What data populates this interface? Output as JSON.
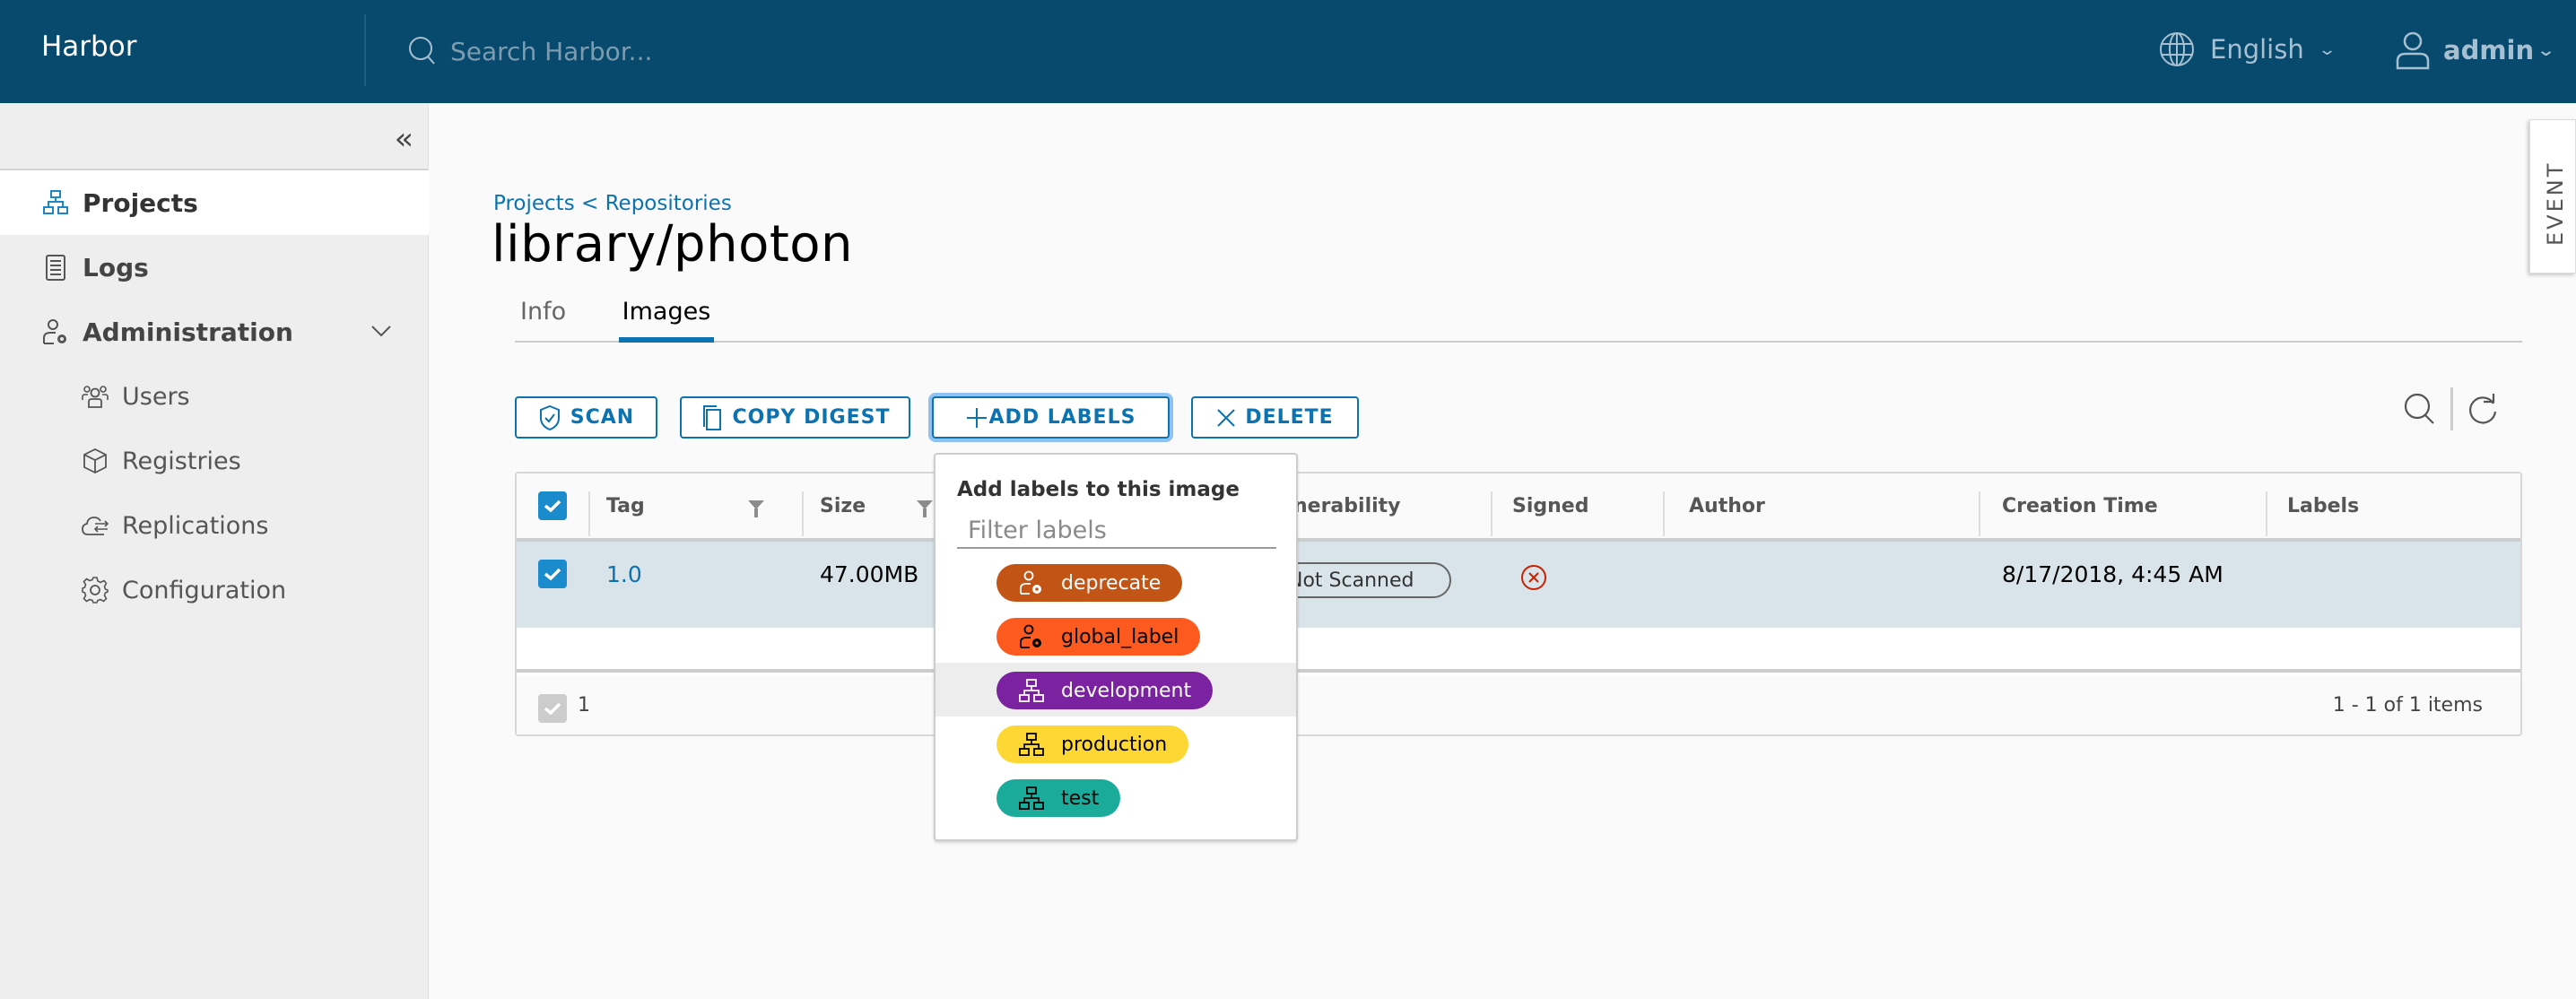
{
  "header": {
    "brand": "Harbor",
    "search_placeholder": "Search Harbor...",
    "language": "English",
    "user": "admin"
  },
  "sidebar": {
    "collapse_icon": "double-chevron-left-icon",
    "items": [
      {
        "label": "Projects",
        "icon": "projects-icon",
        "active": true
      },
      {
        "label": "Logs",
        "icon": "logs-icon",
        "active": false
      },
      {
        "label": "Administration",
        "icon": "administration-icon",
        "expanded": true
      }
    ],
    "sub_items": [
      {
        "label": "Users",
        "icon": "users-icon"
      },
      {
        "label": "Registries",
        "icon": "registries-icon"
      },
      {
        "label": "Replications",
        "icon": "replications-icon"
      },
      {
        "label": "Configuration",
        "icon": "configuration-icon"
      }
    ]
  },
  "breadcrumb": {
    "projects": "Projects",
    "separator": "<",
    "repositories": "Repositories"
  },
  "page_title": "library/photon",
  "tabs": [
    {
      "label": "Info",
      "active": false
    },
    {
      "label": "Images",
      "active": true
    }
  ],
  "toolbar": {
    "scan": "SCAN",
    "copy_digest": "COPY DIGEST",
    "add_labels": "ADD LABELS",
    "delete": "DELETE"
  },
  "table": {
    "columns": [
      "Tag",
      "Size",
      "Vulnerability",
      "Signed",
      "Author",
      "Creation Time",
      "Labels"
    ],
    "visible_vulnerability_header": "nerability",
    "rows": [
      {
        "selected": true,
        "tag": "1.0",
        "size": "47.00MB",
        "vulnerability": "Not Scanned",
        "signed": "not-signed",
        "author": "",
        "creation_time": "8/17/2018, 4:45 AM",
        "labels": ""
      }
    ],
    "footer": {
      "selected_count": "1",
      "pagination": "1 - 1 of 1 items"
    }
  },
  "label_dropdown": {
    "title": "Add labels to this image",
    "filter_placeholder": "Filter labels",
    "labels": [
      {
        "name": "deprecate",
        "scope": "global",
        "color": "#c25516",
        "text_color": "#ffffff"
      },
      {
        "name": "global_label",
        "scope": "global",
        "color": "#fd5a1f",
        "text_color": "#000000"
      },
      {
        "name": "development",
        "scope": "project",
        "color": "#7a22a0",
        "text_color": "#ffffff",
        "hovered": true
      },
      {
        "name": "production",
        "scope": "project",
        "color": "#fdd834",
        "text_color": "#000000"
      },
      {
        "name": "test",
        "scope": "project",
        "color": "#1aab9a",
        "text_color": "#000000"
      }
    ]
  },
  "event_tab": "EVENT",
  "colors": {
    "header_bg": "#084a6d",
    "accent": "#0d72b0",
    "row_selected": "#d9e4ea",
    "signed_error": "#c92100"
  }
}
